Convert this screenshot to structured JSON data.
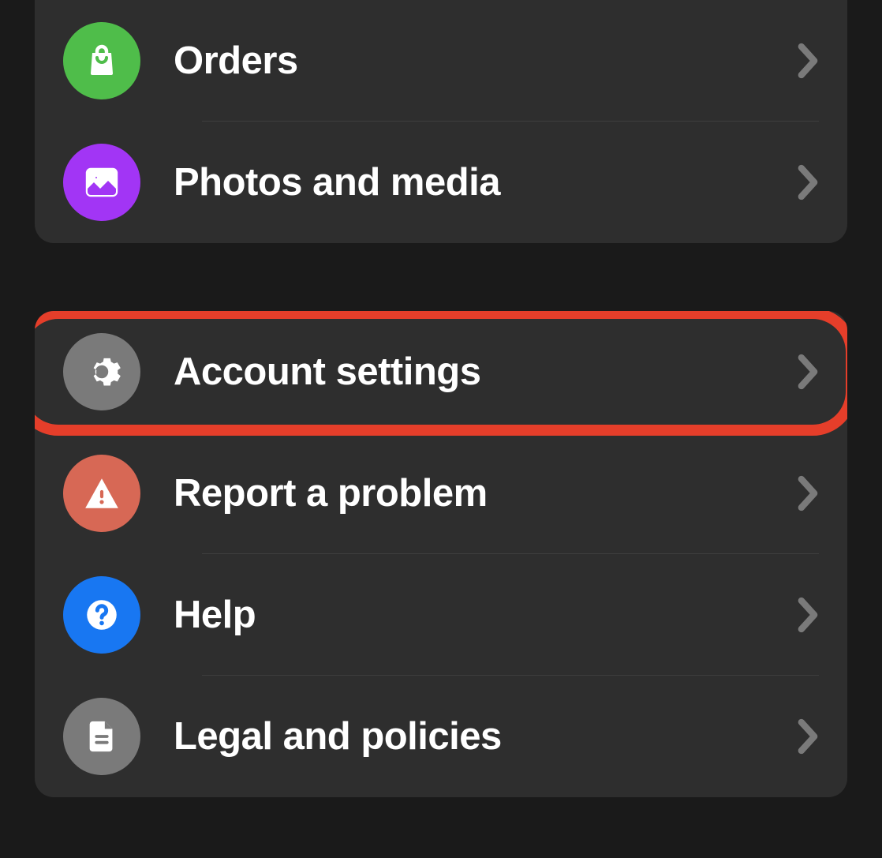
{
  "group1": {
    "items": [
      {
        "label": "Orders",
        "icon": "shopping-bag-icon",
        "bg": "#4fbd4a"
      },
      {
        "label": "Photos and media",
        "icon": "photo-icon",
        "bg": "#a235f5"
      }
    ]
  },
  "group2": {
    "items": [
      {
        "label": "Account settings",
        "icon": "gear-icon",
        "bg": "#7a7a7a",
        "highlight": true
      },
      {
        "label": "Report a problem",
        "icon": "alert-icon",
        "bg": "#d76855"
      },
      {
        "label": "Help",
        "icon": "question-icon",
        "bg": "#1877f2"
      },
      {
        "label": "Legal and policies",
        "icon": "document-icon",
        "bg": "#7a7a7a"
      }
    ]
  },
  "highlight_color": "#e53e2a"
}
